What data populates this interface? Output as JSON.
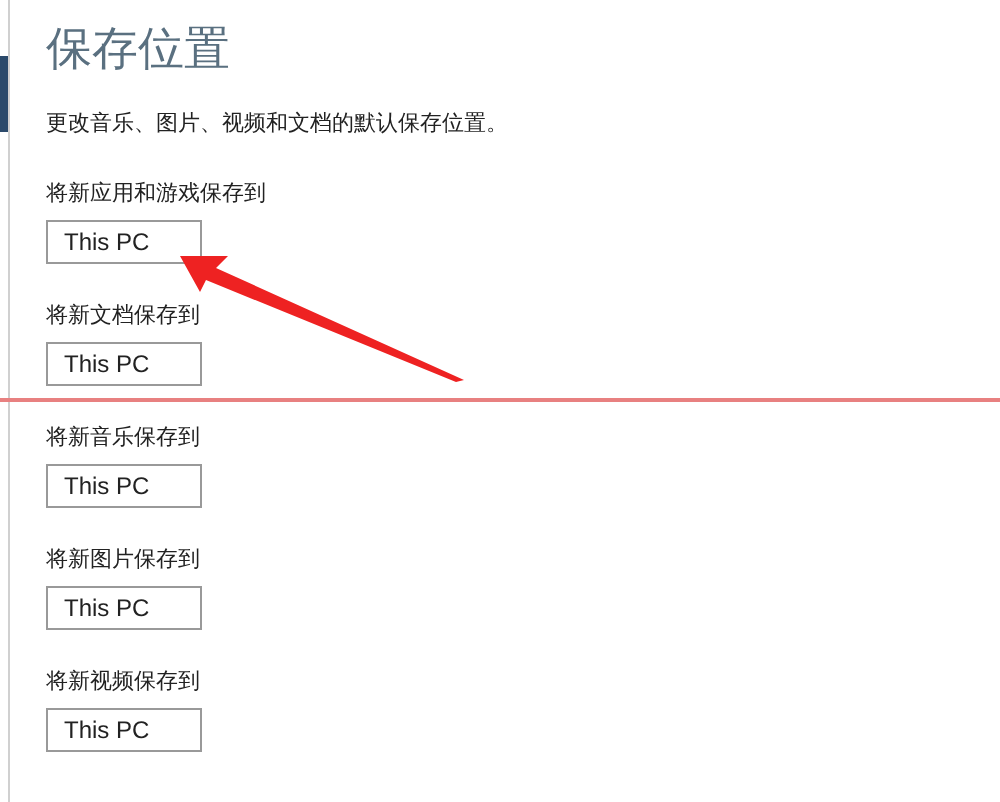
{
  "title": "保存位置",
  "description": "更改音乐、图片、视频和文档的默认保存位置。",
  "settings": [
    {
      "label": "将新应用和游戏保存到",
      "value": "This PC"
    },
    {
      "label": "将新文档保存到",
      "value": "This PC"
    },
    {
      "label": "将新音乐保存到",
      "value": "This PC"
    },
    {
      "label": "将新图片保存到",
      "value": "This PC"
    },
    {
      "label": "将新视频保存到",
      "value": "This PC"
    }
  ]
}
